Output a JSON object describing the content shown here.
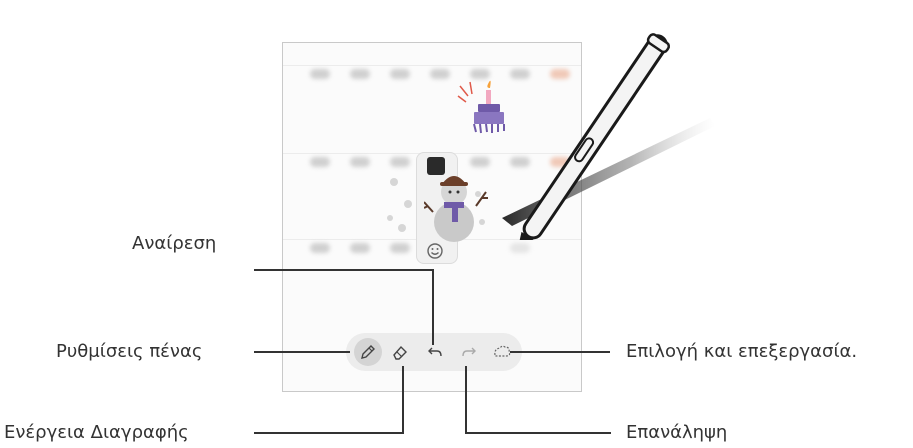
{
  "callouts": {
    "undo": "Αναίρεση",
    "pen_settings": "Ρυθμίσεις πένας",
    "eraser": "Ενέργεια Διαγραφής",
    "select_edit": "Επιλογή και επεξεργασία.",
    "redo": "Επανάληψη"
  },
  "toolbar": {
    "tools": [
      {
        "name": "pen",
        "icon": "pen-icon",
        "selected": true
      },
      {
        "name": "eraser",
        "icon": "eraser-icon",
        "selected": false
      },
      {
        "name": "undo",
        "icon": "undo-icon",
        "selected": false
      },
      {
        "name": "redo",
        "icon": "redo-icon",
        "selected": false,
        "disabled": true
      },
      {
        "name": "selection",
        "icon": "lasso-icon",
        "selected": false
      }
    ]
  },
  "colors": {
    "line": "#333333",
    "toolbar_bg": "#ececec",
    "screen_border": "#c9c9c9",
    "pen_body": "#f4f4f4",
    "pen_outline": "#1a1a1a",
    "cake_candle": "#f7a23a",
    "cake_body": "#6f5aa8",
    "snowman_hat": "#6b3f2a",
    "scarf": "#6f5aa8"
  },
  "stickers": {
    "popup_icons": [
      "black-square-icon",
      "smiley-icon"
    ]
  }
}
